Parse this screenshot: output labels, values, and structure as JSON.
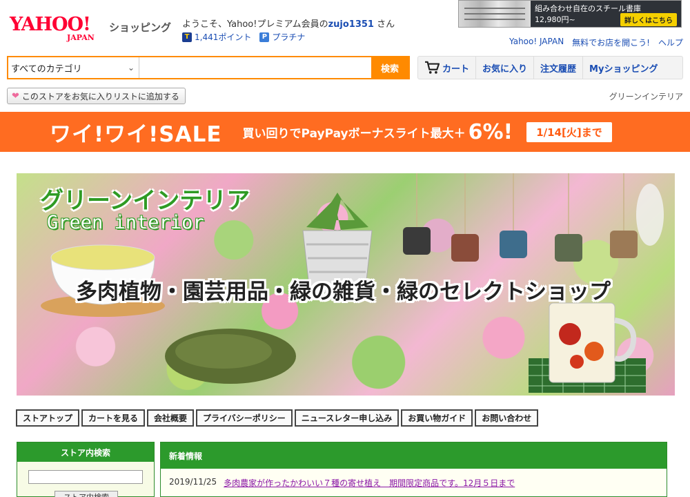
{
  "header": {
    "logo_main": "YAHOO!",
    "logo_sub": "JAPAN",
    "shopping_label": "ショッピング",
    "welcome_prefix": "ようこそ、Yahoo!プレミアム会員の",
    "username": "zujo1351",
    "welcome_suffix": "さん",
    "t_badge": "T",
    "points": "1,441ポイント",
    "p_badge": "P",
    "rank": "プラチナ"
  },
  "top_ad": {
    "title": "組み合わせ自在のスチール書庫",
    "price": "12,980円~",
    "button": "詳しくはこちら"
  },
  "top_links": [
    "Yahoo! JAPAN",
    "無料でお店を開こう!",
    "ヘルプ"
  ],
  "search": {
    "category": "すべてのカテゴリ",
    "value": "",
    "button": "検索"
  },
  "nav": {
    "cart": "カート",
    "favorites": "お気に入り",
    "orders": "注文履歴",
    "my_shopping": "Myショッピング"
  },
  "store": {
    "favorite_button": "このストアをお気に入りリストに追加する",
    "name": "グリーンインテリア"
  },
  "sale": {
    "title": "ワイ!ワイ!SALE",
    "text": "買い回りでPayPayボーナスライト最大＋",
    "percent": "6%!",
    "date": "1/14[火]まで"
  },
  "hero": {
    "title": "グリーンインテリア",
    "subtitle": "Green interior",
    "tagline": "多肉植物・園芸用品・緑の雑貨・緑のセレクトショップ"
  },
  "store_tabs": [
    "ストアトップ",
    "カートを見る",
    "会社概要",
    "プライバシーポリシー",
    "ニュースレター申し込み",
    "お買い物ガイド",
    "お問い合わせ"
  ],
  "sidebar": {
    "title": "ストア内検索",
    "input_value": "",
    "button": "ストア内検索"
  },
  "news": {
    "title": "新着情報",
    "items": [
      {
        "date": "2019/11/25",
        "text": "多肉農家が作ったかわいい７種の寄せ植え　期間限定商品です。12月５日まで"
      }
    ]
  },
  "colors": {
    "yahoo_red": "#ff0033",
    "search_orange": "#ff8a00",
    "sale_orange": "#ff6c21",
    "store_green": "#2c9a2c",
    "link_blue": "#1a4db3"
  }
}
